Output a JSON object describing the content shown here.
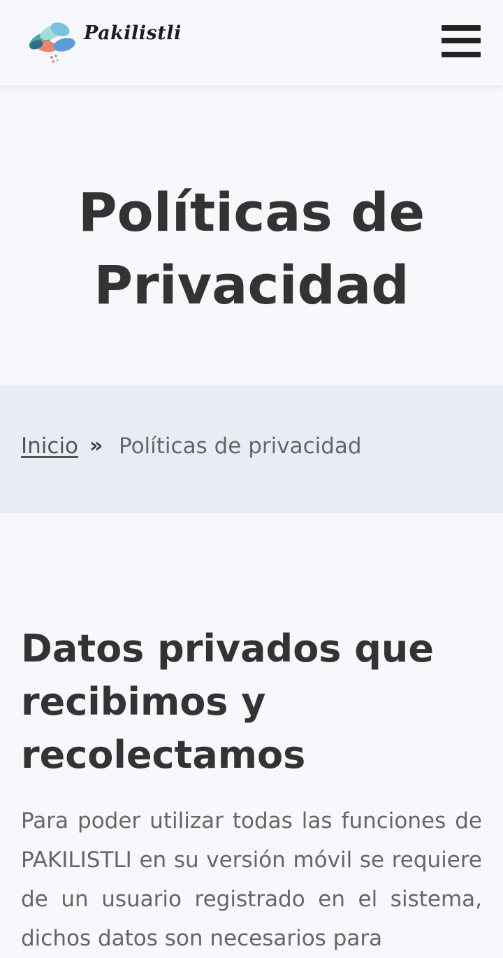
{
  "header": {
    "logo_text": "Pakilistli",
    "logo_icon": "pills-cloud-logo-icon",
    "menu_icon": "hamburger-menu-icon"
  },
  "hero": {
    "title": "Políticas de Privacidad"
  },
  "breadcrumb": {
    "home_label": "Inicio",
    "separator": "»",
    "current_label": "Políticas de privacidad"
  },
  "section": {
    "title": "Datos privados que recibimos y recolectamos",
    "body": "Para poder utilizar todas las funciones de PAKILISTLI en su versión móvil se requiere de un usuario registrado en el sistema, dichos datos son necesarios para"
  },
  "colors": {
    "background": "#f6f8fc",
    "breadcrumb_bg": "#e8edf5",
    "text_dark": "#333333",
    "text_muted": "#666666"
  }
}
